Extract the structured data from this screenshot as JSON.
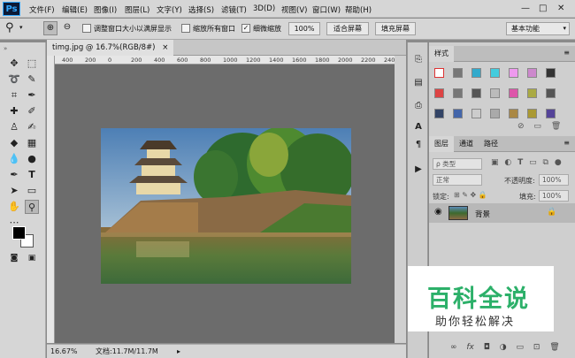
{
  "app": {
    "logo": "Ps"
  },
  "menu": [
    "文件(F)",
    "编辑(E)",
    "图像(I)",
    "图层(L)",
    "文字(Y)",
    "选择(S)",
    "滤镜(T)",
    "3D(D)",
    "视图(V)",
    "窗口(W)",
    "帮助(H)"
  ],
  "window_controls": {
    "minimize": "—",
    "restore": "□",
    "close": "✕"
  },
  "options": {
    "resize_windows_label": "调整窗口大小以满屏显示",
    "resize_windows_checked": false,
    "zoom_all_label": "缩放所有窗口",
    "zoom_all_checked": false,
    "scrubby_zoom_label": "细微缩放",
    "scrubby_zoom_checked": true,
    "btn_100": "100%",
    "btn_fit": "适合屏幕",
    "btn_fill": "填充屏幕",
    "workspace": "基本功能",
    "checkmark": "✓"
  },
  "document": {
    "tab_label": "timg.jpg @ 16.7%(RGB/8#)",
    "close_glyph": "×",
    "ruler_ticks": [
      "400",
      "200",
      "0",
      "200",
      "400",
      "600",
      "800",
      "1000",
      "1200",
      "1400",
      "1600",
      "1800",
      "2000",
      "2200",
      "2400"
    ],
    "zoom": "16.67%",
    "doc_info": "文档:11.7M/11.7M"
  },
  "panels": {
    "styles": {
      "title": "样式"
    },
    "layers": {
      "tabs": [
        "图层",
        "通道",
        "路径"
      ],
      "filter_label": "ρ 类型",
      "blend_mode": "正常",
      "opacity_label": "不透明度:",
      "opacity_value": "100%",
      "lock_label": "锁定:",
      "fill_label": "填充:",
      "fill_value": "100%",
      "layer_name": "背景"
    }
  },
  "watermark": {
    "title": "百科全说",
    "subtitle": "助你轻松解决"
  },
  "colors": {
    "accent": "#31a8ff",
    "ui": "#d6d6d6",
    "canvas": "#6c6c6c",
    "watermark_green": "#2cb069"
  }
}
